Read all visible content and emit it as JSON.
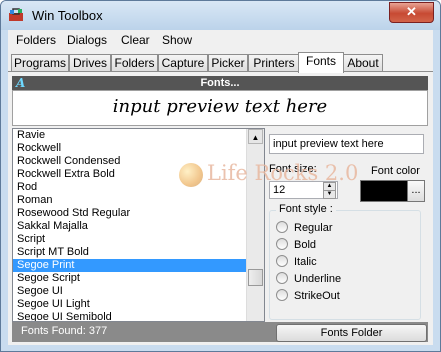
{
  "window": {
    "title": "Win Toolbox",
    "close_glyph": "✕"
  },
  "menu": {
    "items": [
      "Folders",
      "Dialogs",
      "Clear",
      "Show"
    ]
  },
  "tabs": [
    "Programs",
    "Drives",
    "Folders",
    "Capture",
    "Picker",
    "Printers",
    "Fonts",
    "About"
  ],
  "active_tab": "Fonts",
  "fonts_panel": {
    "header": "Fonts...",
    "header_icon": "A",
    "preview_text": "input preview text here",
    "font_list": [
      "Ravie",
      "Rockwell",
      "Rockwell Condensed",
      "Rockwell Extra Bold",
      "Rod",
      "Roman",
      "Rosewood Std Regular",
      "Sakkal Majalla",
      "Script",
      "Script MT Bold",
      "Segoe Print",
      "Segoe Script",
      "Segoe UI",
      "Segoe UI Light",
      "Segoe UI Semibold"
    ],
    "selected_font": "Segoe Print",
    "preview_input": "input preview text here",
    "font_size_label": "Font size:",
    "font_size": "12",
    "font_color_label": "Font color",
    "font_color": "#000000",
    "color_button": "...",
    "font_style_label": "Font style :",
    "styles": [
      "Regular",
      "Bold",
      "Italic",
      "Underline",
      "StrikeOut"
    ],
    "status": "Fonts Found: 377",
    "fonts_folder_button": "Fonts Folder"
  },
  "watermark": "Life Rocks 2.0"
}
